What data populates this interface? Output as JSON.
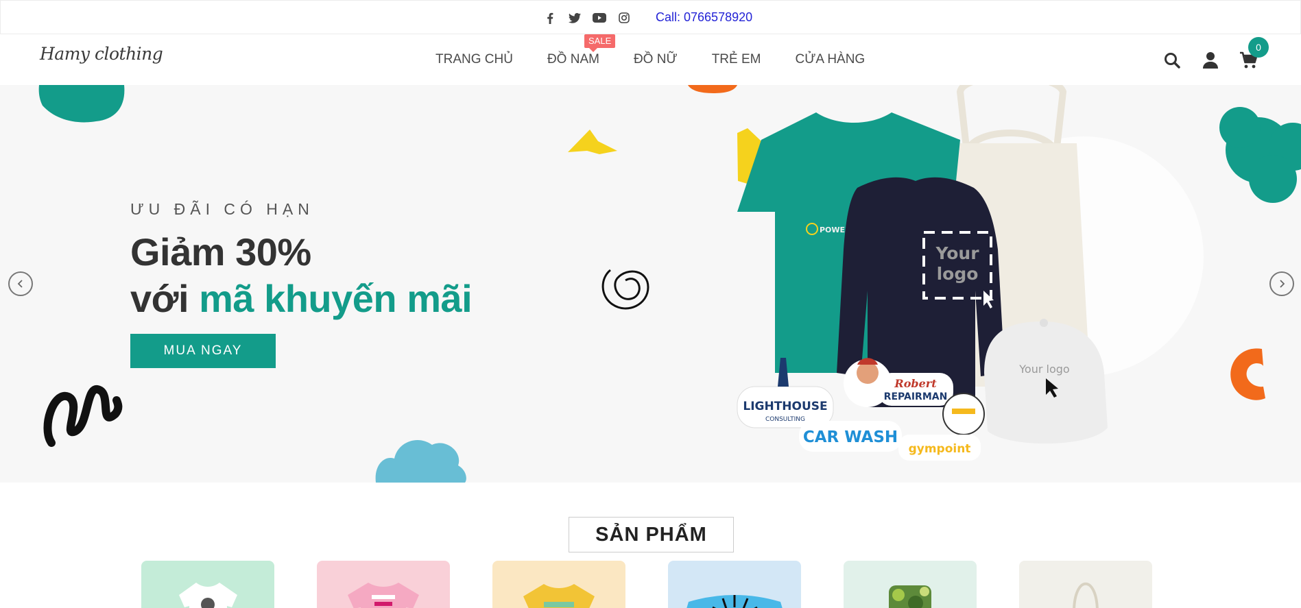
{
  "topbar": {
    "social_icons": [
      "facebook-icon",
      "twitter-icon",
      "youtube-icon",
      "instagram-icon"
    ],
    "call_text": "Call: 0766578920",
    "call_color": "#2323d6"
  },
  "header": {
    "logo_text": "Hamy clothing",
    "nav": [
      "TRANG CHỦ",
      "ĐỒ NAM",
      "ĐỒ NỮ",
      "TRẺ EM",
      "CỬA HÀNG"
    ],
    "sale_badge": "SALE",
    "icons": [
      "search-icon",
      "user-icon",
      "cart-icon"
    ],
    "cart_count": "0",
    "accent_color": "#139c8a"
  },
  "hero": {
    "subtitle": "ƯU ĐÃI CÓ HẠN",
    "title_line1": "Giảm 30%",
    "title_line2_prefix": "với ",
    "title_line2_accent": "mã khuyến mãi",
    "cta_label": "MUA NGAY",
    "image_texts": {
      "shirt_brand": "POWER",
      "sweater_logo_line1": "Your",
      "sweater_logo_line2": "logo",
      "cap_logo": "Your logo",
      "sticker_lighthouse": "LIGHTHOUSE",
      "sticker_lighthouse_sub": "CONSULTING",
      "sticker_robert": "Robert",
      "sticker_repairman": "REPAIRMAN",
      "sticker_carwash": "CAR WASH",
      "sticker_gympoint": "gympoint"
    },
    "prev_icon": "chevron-left-icon",
    "next_icon": "chevron-right-icon"
  },
  "products_section": {
    "title": "SẢN PHẨM",
    "cards": [
      {
        "name": "tshirt-white",
        "bg": "#c4ecd8"
      },
      {
        "name": "tshirt-pink",
        "bg": "#f9d0d8"
      },
      {
        "name": "tshirt-yellow",
        "bg": "#fbe7c2"
      },
      {
        "name": "pillow-blue",
        "bg": "#d3e7f6"
      },
      {
        "name": "phone-case-camo",
        "bg": "#e1f1ea"
      },
      {
        "name": "tote-bag",
        "bg": "#f1f0ea"
      }
    ]
  }
}
